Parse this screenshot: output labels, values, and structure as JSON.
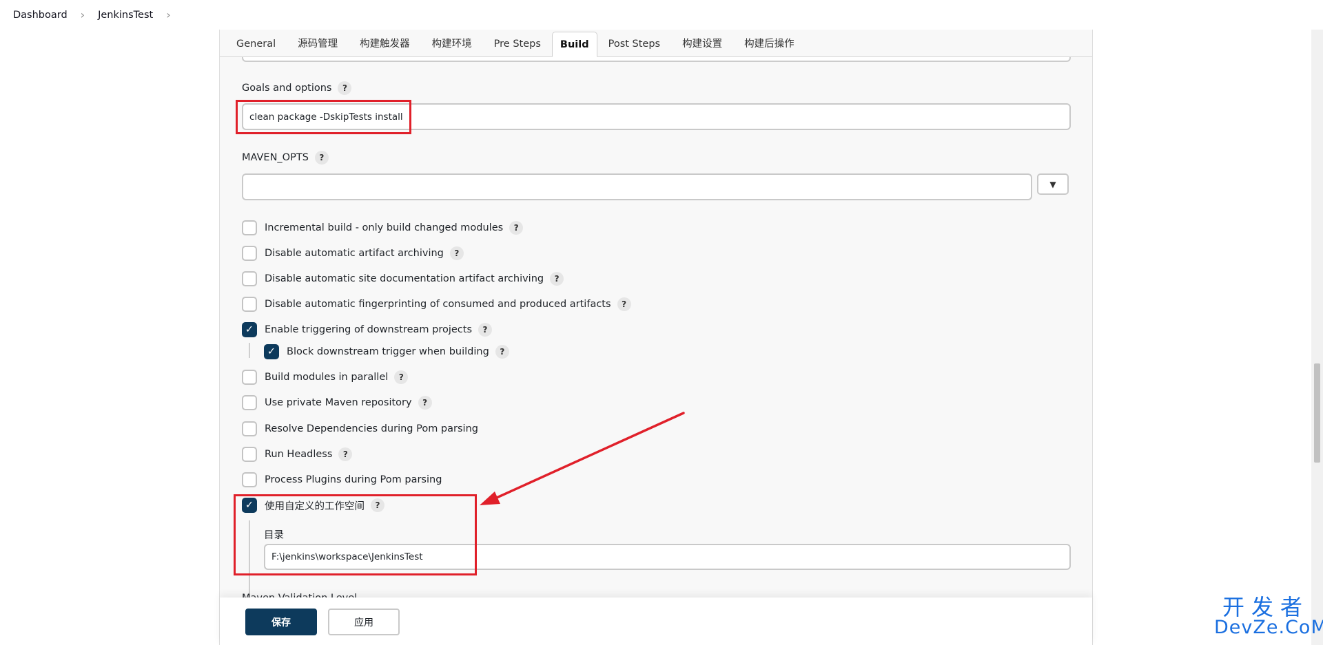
{
  "breadcrumb": {
    "items": [
      "Dashboard",
      "JenkinsTest"
    ]
  },
  "tabs": [
    "General",
    "源码管理",
    "构建触发器",
    "构建环境",
    "Pre Steps",
    "Build",
    "Post Steps",
    "构建设置",
    "构建后操作"
  ],
  "active_tab": "Build",
  "fields": {
    "goals_label": "Goals and options",
    "goals_value": "clean package -DskipTests install",
    "maven_opts_label": "MAVEN_OPTS",
    "maven_opts_value": "",
    "directory_label": "目录",
    "directory_value": "F:\\jenkins\\workspace\\JenkinsTest",
    "maven_validation_label": "Maven Validation Level"
  },
  "checkboxes": {
    "incremental": {
      "label": "Incremental build - only build changed modules",
      "checked": false
    },
    "disable_archiving": {
      "label": "Disable automatic artifact archiving",
      "checked": false
    },
    "disable_site_doc": {
      "label": "Disable automatic site documentation artifact archiving",
      "checked": false
    },
    "disable_fingerprinting": {
      "label": "Disable automatic fingerprinting of consumed and produced artifacts",
      "checked": false
    },
    "enable_downstream": {
      "label": "Enable triggering of downstream projects",
      "checked": true
    },
    "block_downstream": {
      "label": "Block downstream trigger when building",
      "checked": true
    },
    "parallel_modules": {
      "label": "Build modules in parallel",
      "checked": false
    },
    "private_repo": {
      "label": "Use private Maven repository",
      "checked": false
    },
    "resolve_deps": {
      "label": "Resolve Dependencies during Pom parsing",
      "checked": false
    },
    "run_headless": {
      "label": "Run Headless",
      "checked": false
    },
    "process_plugins": {
      "label": "Process Plugins during Pom parsing",
      "checked": false
    },
    "custom_workspace": {
      "label": "使用自定义的工作空间",
      "checked": true
    }
  },
  "help_glyph": "?",
  "buttons": {
    "save": "保存",
    "apply": "应用",
    "dropdown_glyph": "▼"
  },
  "check_glyph": "✓",
  "breadcrumb_separator": "›",
  "watermark": {
    "line1": "开发者",
    "line2": "DevZe.CoM"
  },
  "annotation_color": "#e0202a",
  "accent_color": "#0d3a5c"
}
